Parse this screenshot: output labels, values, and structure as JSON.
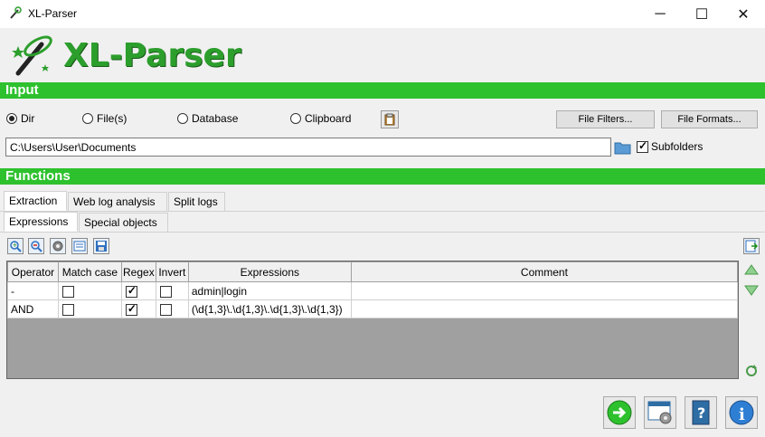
{
  "window": {
    "title": "XL-Parser"
  },
  "header": {
    "logo_text": "XL-Parser"
  },
  "input": {
    "section_title": "Input",
    "radios": [
      {
        "label": "Dir",
        "selected": true
      },
      {
        "label": "File(s)",
        "selected": false
      },
      {
        "label": "Database",
        "selected": false
      },
      {
        "label": "Clipboard",
        "selected": false
      }
    ],
    "file_filters_label": "File Filters...",
    "file_formats_label": "File Formats...",
    "path_value": "C:\\Users\\User\\Documents",
    "subfolders_label": "Subfolders",
    "subfolders_checked": true
  },
  "functions": {
    "section_title": "Functions",
    "tabs": [
      {
        "label": "Extraction",
        "active": true
      },
      {
        "label": "Web log analysis",
        "active": false
      },
      {
        "label": "Split logs",
        "active": false
      }
    ],
    "subtabs": [
      {
        "label": "Expressions",
        "active": true
      },
      {
        "label": "Special objects",
        "active": false
      }
    ]
  },
  "grid": {
    "headers": [
      "Operator",
      "Match case",
      "Regex",
      "Invert",
      "Expressions",
      "Comment"
    ],
    "rows": [
      {
        "operator": "-",
        "match_case": false,
        "regex": true,
        "invert": false,
        "expression": "admin|login",
        "comment": ""
      },
      {
        "operator": "AND",
        "match_case": false,
        "regex": true,
        "invert": false,
        "expression": "(\\d{1,3}\\.\\d{1,3}\\.\\d{1,3}\\.\\d{1,3})",
        "comment": ""
      }
    ]
  },
  "colors": {
    "accent_green": "#2ec12e",
    "logo_green": "#2c9e2c"
  }
}
